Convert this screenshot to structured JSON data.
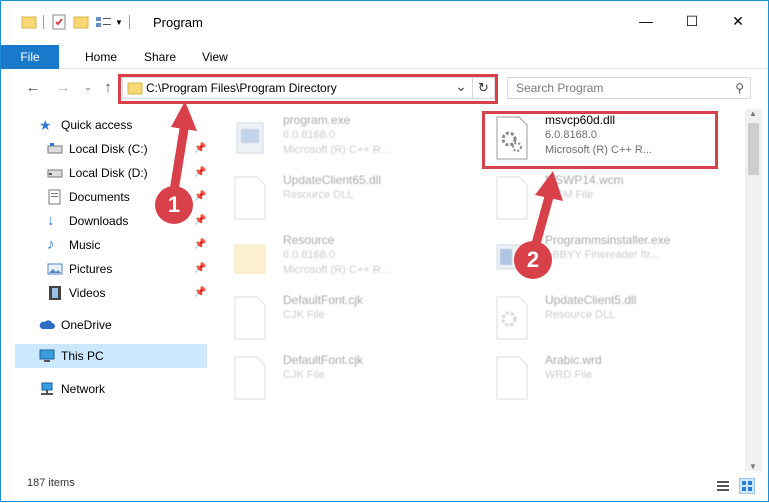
{
  "window": {
    "title": "Program",
    "controls": {
      "minimize": "—",
      "maximize": "☐",
      "close": "✕"
    }
  },
  "ribbon": {
    "tabs": [
      "File",
      "Home",
      "Share",
      "View"
    ]
  },
  "address": {
    "path": "C:\\Program Files\\Program Directory",
    "dropdown": "⌄",
    "refresh": "↻"
  },
  "search": {
    "placeholder": "Search Program",
    "icon": "search-icon"
  },
  "sidebar": {
    "items": [
      {
        "label": "Quick access",
        "icon": "star-icon",
        "pinned": false
      },
      {
        "label": "Local Disk (C:)",
        "icon": "drive-icon",
        "pinned": true
      },
      {
        "label": "Local Disk (D:)",
        "icon": "drive-icon",
        "pinned": true
      },
      {
        "label": "Documents",
        "icon": "documents-icon",
        "pinned": true
      },
      {
        "label": "Downloads",
        "icon": "download-icon",
        "pinned": true
      },
      {
        "label": "Music",
        "icon": "music-icon",
        "pinned": true
      },
      {
        "label": "Pictures",
        "icon": "pictures-icon",
        "pinned": true
      },
      {
        "label": "Videos",
        "icon": "video-icon",
        "pinned": true
      },
      {
        "label": "OneDrive",
        "icon": "cloud-icon",
        "pinned": false
      },
      {
        "label": "This PC",
        "icon": "computer-icon",
        "pinned": false,
        "selected": true
      },
      {
        "label": "Network",
        "icon": "network-icon",
        "pinned": false
      }
    ]
  },
  "files": [
    {
      "name": "program.exe",
      "line2": "6.0.8168.0",
      "line3": "Microsoft (R) C++ R...",
      "faded": true
    },
    {
      "name": "msvcp60d.dll",
      "line2": "6.0.8168.0",
      "line3": "Microsoft (R) C++ R...",
      "faded": false
    },
    {
      "name": "UpdateClient65.dll",
      "line2": "Resource DLL",
      "line3": "",
      "faded": true
    },
    {
      "name": "MSWP14.wcm",
      "line2": "WCM File",
      "line3": "",
      "faded": true
    },
    {
      "name": "Resource",
      "line2": "6.0.8168.0",
      "line3": "Microsoft (R) C++ R...",
      "faded": true
    },
    {
      "name": "Programmsinstaller.exe",
      "line2": "ABBYY Finereader ftr...",
      "line3": "",
      "faded": true
    },
    {
      "name": "DefaultFont.cjk",
      "line2": "CJK File",
      "line3": "",
      "faded": true
    },
    {
      "name": "UpdateClient5.dll",
      "line2": "Resource DLL",
      "line3": "",
      "faded": true
    },
    {
      "name": "DefaultFont.cjk",
      "line2": "CJK File",
      "line3": "",
      "faded": true
    },
    {
      "name": "Arabic.wrd",
      "line2": "WRD File",
      "line3": "",
      "faded": true
    }
  ],
  "status": {
    "item_count": "187 items"
  },
  "annotations": {
    "step1": "1",
    "step2": "2",
    "color": "#d9414a"
  }
}
